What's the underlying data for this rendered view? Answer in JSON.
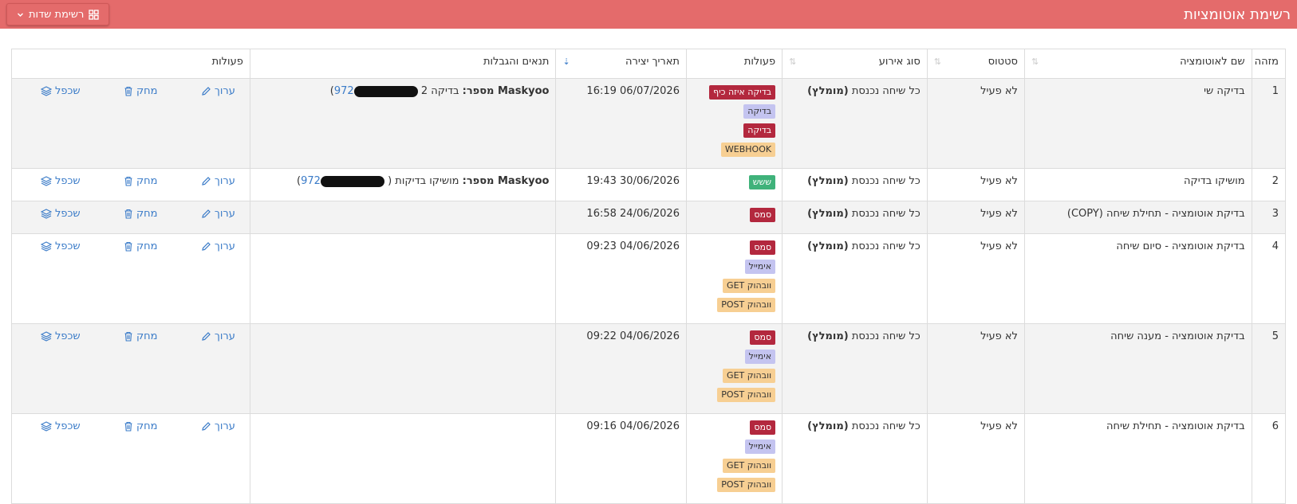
{
  "header": {
    "title": "רשימת אוטומציות",
    "fields_button": "רשימת שדות"
  },
  "columns": {
    "id": "מזהה",
    "name": "שם לאוטומציה",
    "status": "סטטוס",
    "event_type": "סוג אירוע",
    "actions": "פעולות",
    "created": "תאריך יצירה",
    "conditions": "תנאים והגבלות",
    "ops": "פעולות"
  },
  "row_actions": {
    "edit": "ערוך",
    "delete": "מחק",
    "duplicate": "שכפל"
  },
  "rows": [
    {
      "id": "1",
      "name": "בדיקה שי",
      "status": "לא פעיל",
      "event": "כל שיחה נכנסת",
      "event_tag": "(מומלץ)",
      "actions": [
        {
          "label": "בדיקה איזה כיף",
          "color": "red"
        },
        {
          "label": "בדיקה",
          "color": "lav"
        },
        {
          "label": "בדיקה",
          "color": "red"
        },
        {
          "label": "WEBHOOK",
          "color": "orange"
        }
      ],
      "created": "06/07/2026 16:19",
      "cond_brand": "Maskyoo מספר:",
      "cond_text": "בדיקה 2",
      "cond_phone": "972"
    },
    {
      "id": "2",
      "name": "מושיקו בדיקה",
      "status": "לא פעיל",
      "event": "כל שיחה נכנסת",
      "event_tag": "(מומלץ)",
      "actions": [
        {
          "label": "ששש",
          "color": "green"
        }
      ],
      "created": "30/06/2026 19:43",
      "cond_brand": "Maskyoo מספר:",
      "cond_text": "מושיקו בדיקות (",
      "cond_phone": "972"
    },
    {
      "id": "3",
      "name": "בדיקת אוטומציה - תחילת שיחה (COPY)",
      "status": "לא פעיל",
      "event": "כל שיחה נכנסת",
      "event_tag": "(מומלץ)",
      "actions": [
        {
          "label": "סמס",
          "color": "red"
        }
      ],
      "created": "24/06/2026 16:58"
    },
    {
      "id": "4",
      "name": "בדיקת אוטומציה - סיום שיחה",
      "status": "לא פעיל",
      "event": "כל שיחה נכנסת",
      "event_tag": "(מומלץ)",
      "actions": [
        {
          "label": "סמס",
          "color": "red"
        },
        {
          "label": "אימייל",
          "color": "lav"
        },
        {
          "label": "וובהוק GET",
          "color": "orange"
        },
        {
          "label": "וובהוק POST",
          "color": "orange"
        }
      ],
      "created": "04/06/2026 09:23"
    },
    {
      "id": "5",
      "name": "בדיקת אוטומציה - מענה שיחה",
      "status": "לא פעיל",
      "event": "כל שיחה נכנסת",
      "event_tag": "(מומלץ)",
      "actions": [
        {
          "label": "סמס",
          "color": "red"
        },
        {
          "label": "אימייל",
          "color": "lav"
        },
        {
          "label": "וובהוק GET",
          "color": "orange"
        },
        {
          "label": "וובהוק POST",
          "color": "orange"
        }
      ],
      "created": "04/06/2026 09:22"
    },
    {
      "id": "6",
      "name": "בדיקת אוטומציה - תחילת שיחה",
      "status": "לא פעיל",
      "event": "כל שיחה נכנסת",
      "event_tag": "(מומלץ)",
      "actions": [
        {
          "label": "סמס",
          "color": "red"
        },
        {
          "label": "אימייל",
          "color": "lav"
        },
        {
          "label": "וובהוק GET",
          "color": "orange"
        },
        {
          "label": "וובהוק POST",
          "color": "orange"
        }
      ],
      "created": "04/06/2026 09:16"
    }
  ]
}
